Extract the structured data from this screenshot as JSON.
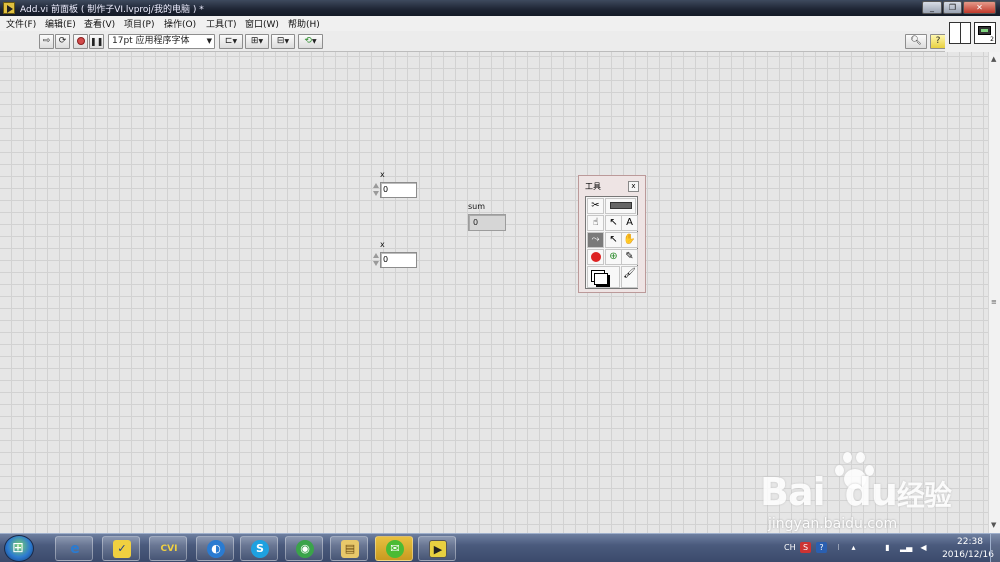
{
  "window": {
    "title": "Add.vi 前面板 ( 制作子VI.lvproj/我的电脑 ) *",
    "controls": {
      "minimize": "_",
      "restore": "❐",
      "close": "✕"
    }
  },
  "menu": [
    "文件(F)",
    "编辑(E)",
    "查看(V)",
    "项目(P)",
    "操作(O)",
    "工具(T)",
    "窗口(W)",
    "帮助(H)"
  ],
  "toolbar": {
    "run_icon": "run-arrow-icon",
    "run_continuous_icon": "run-continuously-icon",
    "abort_icon": "abort-icon",
    "pause_icon": "pause-icon",
    "font_label": "17pt 应用程序字体",
    "align_icon": "align-objects-icon",
    "distribute_icon": "distribute-objects-icon",
    "resize_icon": "resize-objects-icon",
    "reorder_icon": "reorder-icon",
    "search_icon": "search-icon",
    "help_icon": "help-icon",
    "help_glyph": "?"
  },
  "icon_pane": {
    "vi_icon_number": "2"
  },
  "front_panel": {
    "control_1": {
      "label": "x",
      "value": "0"
    },
    "control_2": {
      "label": "x",
      "value": "0"
    },
    "indicator": {
      "label": "sum",
      "value": "0"
    }
  },
  "tools_palette": {
    "title": "工具",
    "close": "x",
    "tools": [
      "automatic-tool-selection-icon",
      "operate-value-icon",
      "position-size-select-icon",
      "edit-text-icon",
      "connect-wire-icon",
      "object-shortcut-menu-icon",
      "scroll-window-icon",
      "set-clear-breakpoint-icon",
      "probe-data-icon",
      "get-color-icon",
      "set-color-icon"
    ]
  },
  "taskbar": {
    "apps": [
      "internet-explorer-icon",
      "visio-icon",
      "cvi-icon",
      "browser-icon",
      "skype-icon",
      "media-player-icon",
      "file-explorer-icon",
      "wechat-icon",
      "labview-icon"
    ],
    "cvi_label": "CVI",
    "tray_language": "CH",
    "clock_time": "22:38",
    "clock_date": "2016/12/16"
  },
  "watermark": {
    "logo_left": "Bai",
    "logo_right": "du",
    "logo_cn": "经验",
    "url": "jingyan.baidu.com"
  },
  "colors": {
    "canvas": "#e6e6e6",
    "grid": "#d2d2d2",
    "titlebar": "#1d2433",
    "taskbar": "#4a5a7d"
  }
}
